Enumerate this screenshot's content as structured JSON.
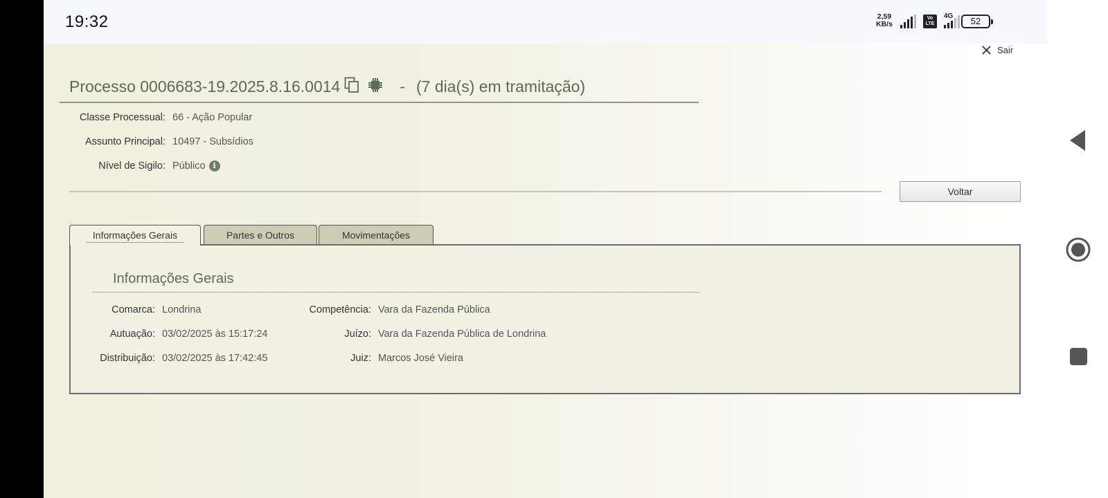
{
  "status_bar": {
    "time": "19:32",
    "net_speed_value": "2,59",
    "net_speed_unit": "KB/s",
    "volte_top": "Vo",
    "volte_bottom": "LTE",
    "network_type": "4G",
    "battery": "52"
  },
  "header": {
    "sair_label": "Sair",
    "title": "Processo 0006683-19.2025.8.16.0014",
    "separator": "-",
    "tramitacao": "(7 dia(s) em tramitação)",
    "classe_label": "Classe Processual:",
    "classe_value": "66 - Ação Popular",
    "assunto_label": "Assunto Principal:",
    "assunto_value": "10497 - Subsídios",
    "sigilo_label": "Nível de Sigilo:",
    "sigilo_value": "Público",
    "voltar_label": "Voltar"
  },
  "tabs": [
    {
      "label": "Informações Gerais",
      "active": true
    },
    {
      "label": "Partes e Outros",
      "active": false
    },
    {
      "label": "Movimentações",
      "active": false
    }
  ],
  "panel": {
    "title": "Informações Gerais",
    "left_fields": [
      {
        "label": "Comarca:",
        "value": "Londrina"
      },
      {
        "label": "Autuação:",
        "value": "03/02/2025 às 15:17:24"
      },
      {
        "label": "Distribuição:",
        "value": "03/02/2025 às 17:42:45"
      }
    ],
    "right_fields": [
      {
        "label": "Competência:",
        "value": "Vara da Fazenda Pública"
      },
      {
        "label": "Juízo:",
        "value": "Vara da Fazenda Pública de Londrina"
      },
      {
        "label": "Juiz:",
        "value": "Marcos José Vieira"
      }
    ]
  },
  "colors": {
    "title_green": "#5b6b58",
    "page_bg": "#eff0dd",
    "tab_inactive": "#cfccb6",
    "panel_bg": "#f1f2e4"
  }
}
